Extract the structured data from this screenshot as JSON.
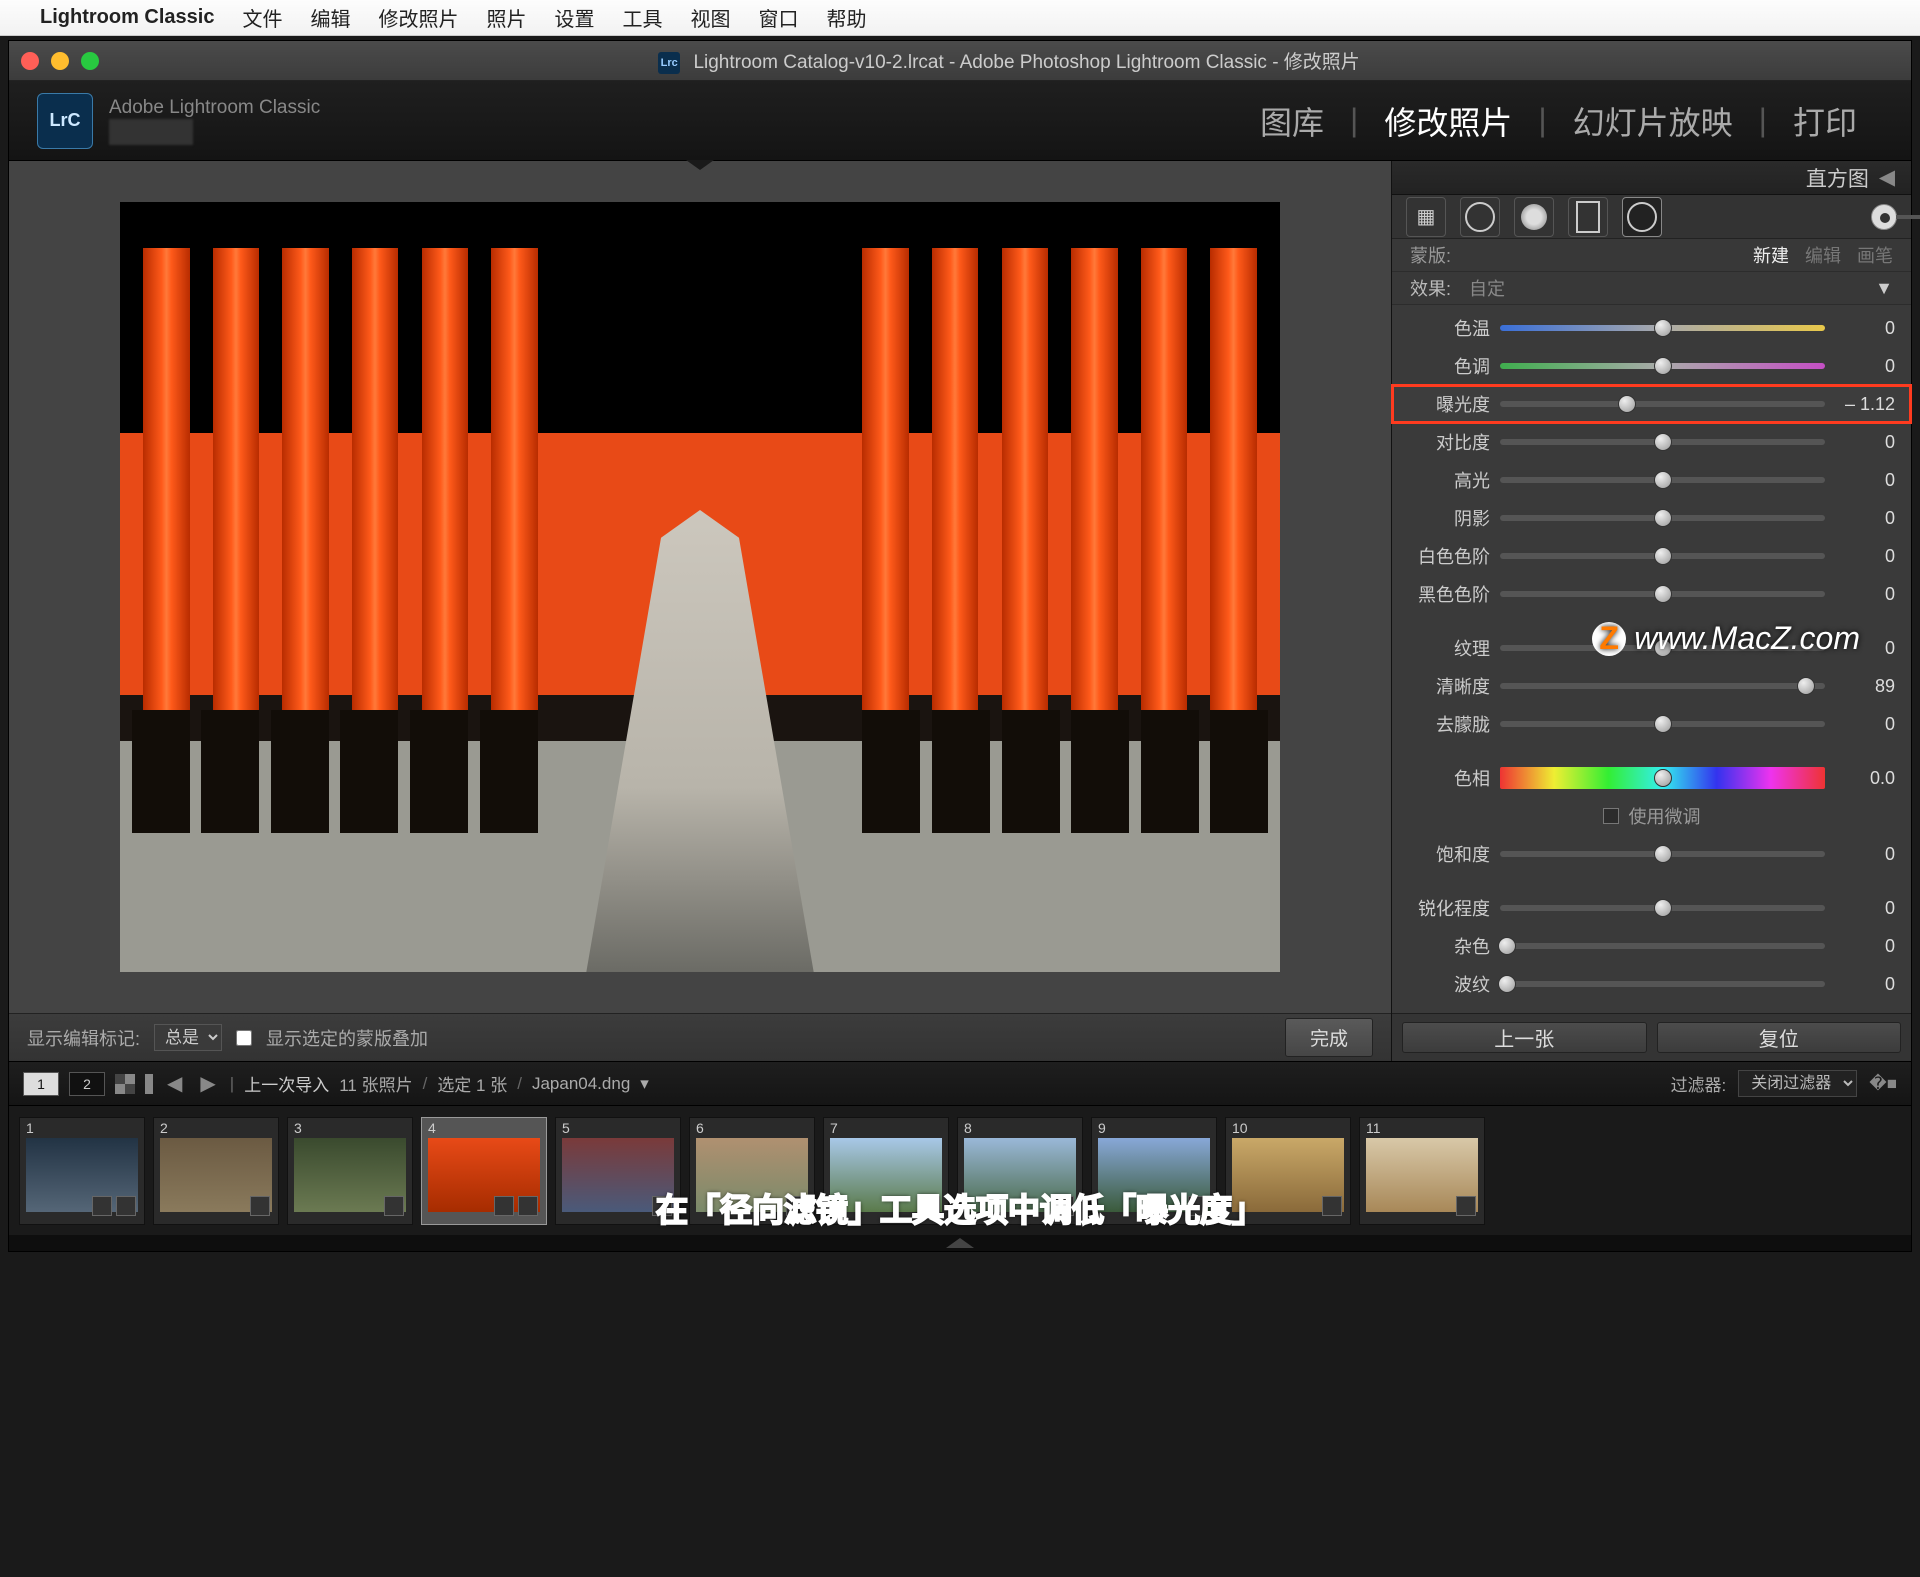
{
  "mac_menu": {
    "app_name": "Lightroom Classic",
    "items": [
      "文件",
      "编辑",
      "修改照片",
      "照片",
      "设置",
      "工具",
      "视图",
      "窗口",
      "帮助"
    ]
  },
  "window": {
    "title": "Lightroom Catalog-v10-2.lrcat - Adobe Photoshop Lightroom Classic - 修改照片"
  },
  "header": {
    "brand": "Adobe Lightroom Classic",
    "logo": "LrC",
    "modules": [
      "图库",
      "修改照片",
      "幻灯片放映",
      "打印"
    ],
    "active_module": "修改照片"
  },
  "canvas_footer": {
    "label": "显示编辑标记:",
    "mode": "总是",
    "checkbox_label": "显示选定的蒙版叠加",
    "done": "完成"
  },
  "panel": {
    "histogram": "直方图",
    "mask_label": "蒙版:",
    "mask_tabs": [
      "新建",
      "编辑",
      "画笔"
    ],
    "mask_active": "新建",
    "effect_label": "效果:",
    "effect_value": "自定",
    "sliders": {
      "temp": {
        "label": "色温",
        "value": "0",
        "pos": 50
      },
      "tint": {
        "label": "色调",
        "value": "0",
        "pos": 50
      },
      "exposure": {
        "label": "曝光度",
        "value": "– 1.12",
        "pos": 39
      },
      "contrast": {
        "label": "对比度",
        "value": "0",
        "pos": 50
      },
      "highlights": {
        "label": "高光",
        "value": "0",
        "pos": 50
      },
      "shadows": {
        "label": "阴影",
        "value": "0",
        "pos": 50
      },
      "whites": {
        "label": "白色色阶",
        "value": "0",
        "pos": 50
      },
      "blacks": {
        "label": "黑色色阶",
        "value": "0",
        "pos": 50
      },
      "texture": {
        "label": "纹理",
        "value": "0",
        "pos": 50
      },
      "clarity": {
        "label": "清晰度",
        "value": "89",
        "pos": 94
      },
      "dehaze": {
        "label": "去朦胧",
        "value": "0",
        "pos": 50
      },
      "hue": {
        "label": "色相",
        "value": "0.0",
        "pos": 50
      },
      "fine_adjust": "使用微调",
      "saturation": {
        "label": "饱和度",
        "value": "0",
        "pos": 50
      },
      "sharpness": {
        "label": "锐化程度",
        "value": "0",
        "pos": 50
      },
      "noise": {
        "label": "杂色",
        "value": "0",
        "pos": 2
      },
      "moire": {
        "label": "波纹",
        "value": "0",
        "pos": 2
      }
    },
    "footer": {
      "prev": "上一张",
      "reset": "复位"
    }
  },
  "filmstrip_bar": {
    "view1": "1",
    "view2": "2",
    "crumb": "上一次导入",
    "count": "11 张照片",
    "selected": "选定 1 张",
    "filename": "Japan04.dng",
    "filter_label": "过滤器:",
    "filter_value": "关闭过滤器"
  },
  "thumbs": [
    1,
    2,
    3,
    4,
    5,
    6,
    7,
    8,
    9,
    10,
    11
  ],
  "caption": "在「径向滤镜」工具选项中调低「曝光度」",
  "watermark": "www.MacZ.com"
}
